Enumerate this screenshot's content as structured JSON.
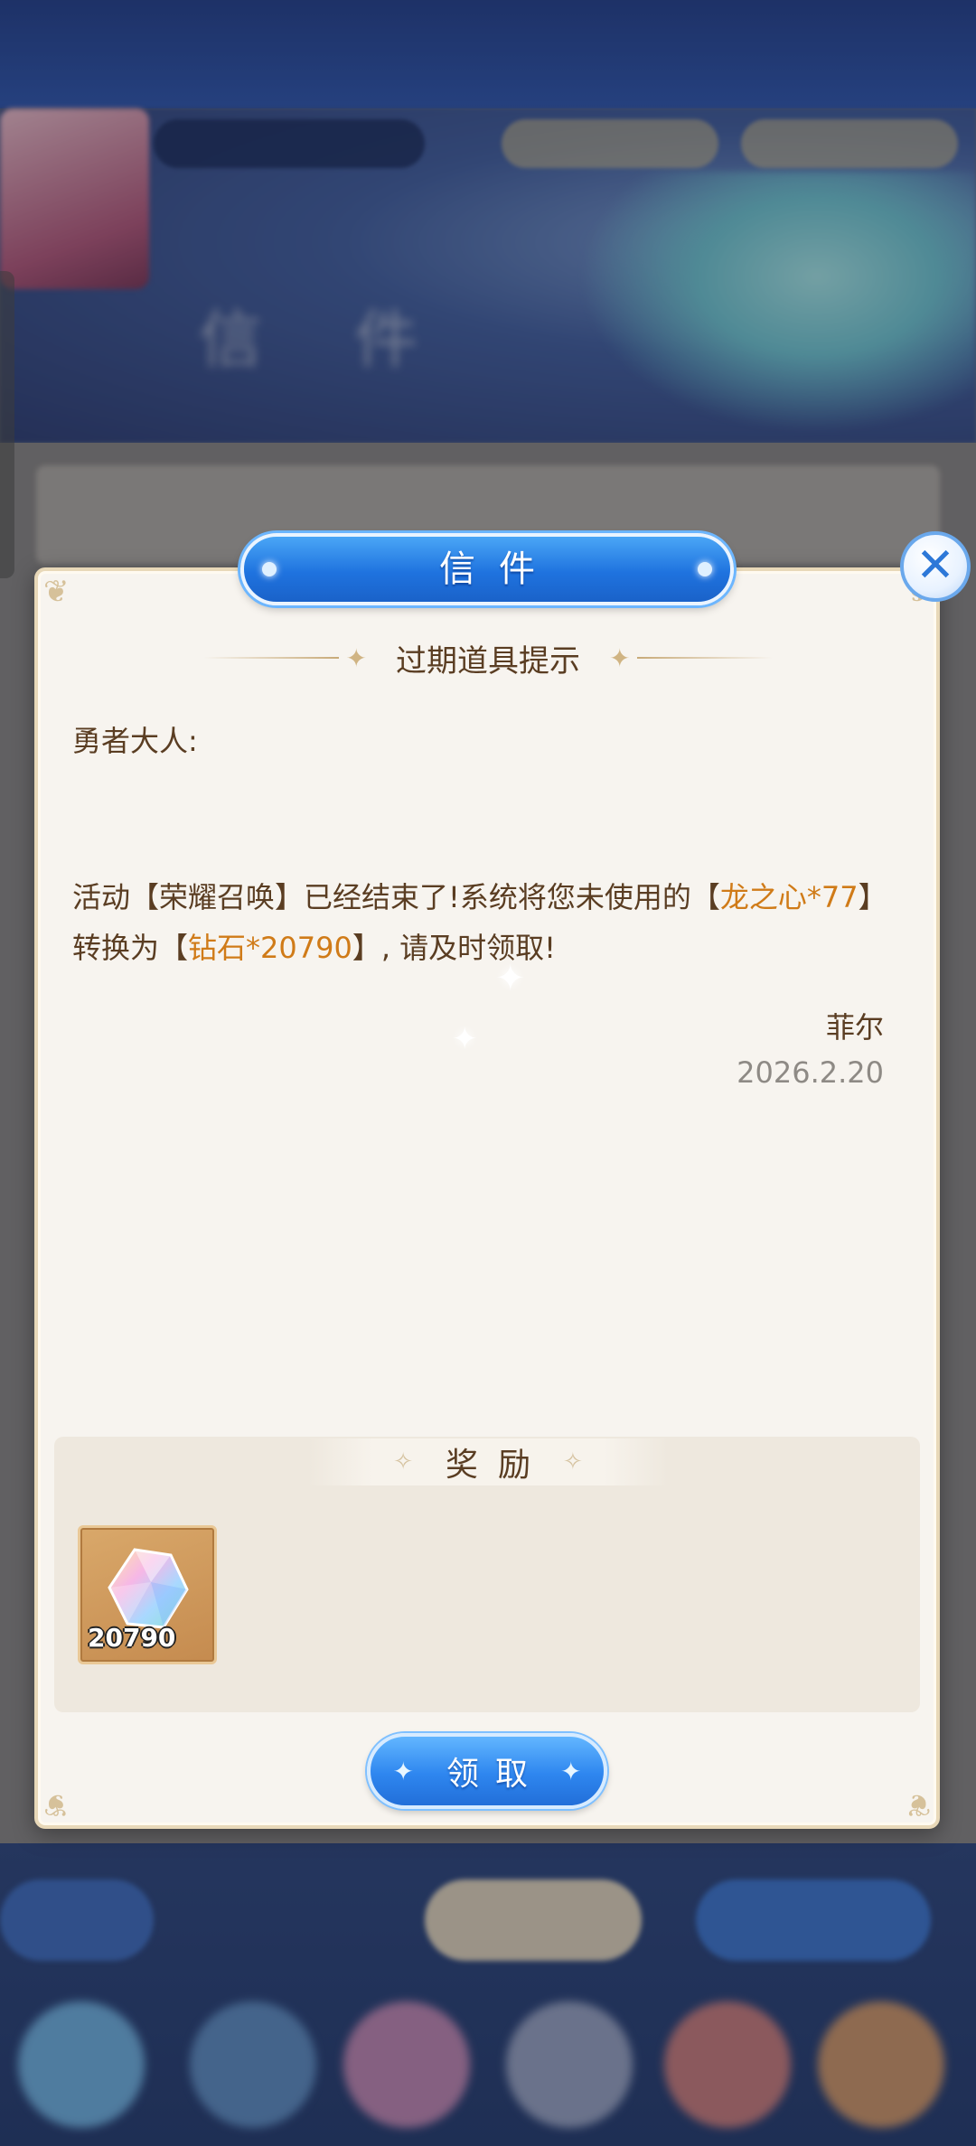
{
  "background": {
    "bg_title": "信 件",
    "blurred": true
  },
  "dialog": {
    "title": "信件",
    "close_icon": "close-icon",
    "subject": "过期道具提示",
    "salutation": "勇者大人:",
    "body": {
      "part1": "活动【荣耀召唤】已经结束了!系统将您未使用的【",
      "highlight1": "龙之心*77",
      "part2": "】转换为【",
      "highlight2": "钻石*20790",
      "part3": "】, 请及时领取!"
    },
    "signature": "菲尔",
    "date": "2026.2.20",
    "rewards": {
      "label": "奖励",
      "items": [
        {
          "icon": "diamond-gem-icon",
          "count": "20790"
        }
      ]
    },
    "claim_button": "领取"
  },
  "colors": {
    "accent_blue": "#2e86ef",
    "highlight_orange": "#d07b18",
    "text_brown": "#5a3d22",
    "date_gray": "#8e8a85",
    "paper": "#f7f4ef"
  }
}
